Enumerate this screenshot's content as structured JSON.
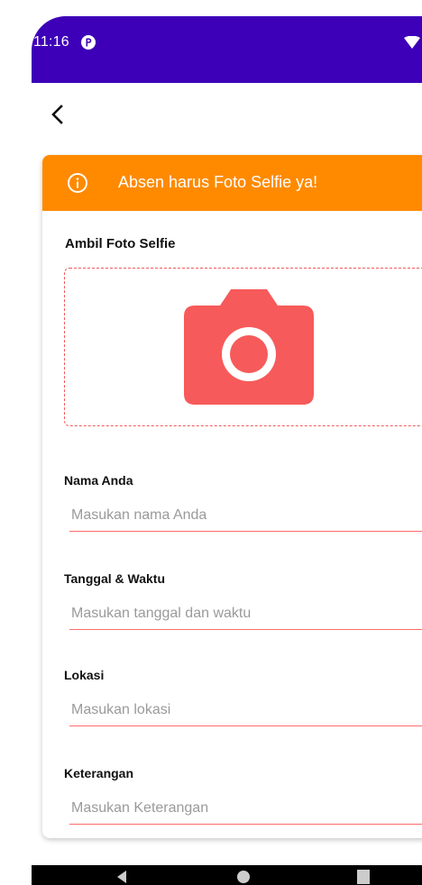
{
  "status_bar": {
    "time": "11:16"
  },
  "icons": {
    "status_p": "p-circle-icon",
    "wifi": "wifi-icon",
    "back": "chevron-left-icon",
    "info": "info-icon",
    "camera": "camera-icon"
  },
  "banner": {
    "text": "Absen harus Foto Selfie ya!"
  },
  "photo": {
    "title": "Ambil Foto Selfie"
  },
  "fields": [
    {
      "label": "Nama Anda",
      "placeholder": "Masukan nama Anda",
      "value": ""
    },
    {
      "label": "Tanggal & Waktu",
      "placeholder": "Masukan tanggal dan waktu",
      "value": ""
    },
    {
      "label": "Lokasi",
      "placeholder": "Masukan lokasi",
      "value": ""
    },
    {
      "label": "Keterangan",
      "placeholder": "Masukan Keterangan",
      "value": ""
    }
  ],
  "colors": {
    "status_bar": "#3d00b8",
    "banner": "#ff8a00",
    "accent": "#ff6b6b",
    "camera": "#f75a5a"
  }
}
